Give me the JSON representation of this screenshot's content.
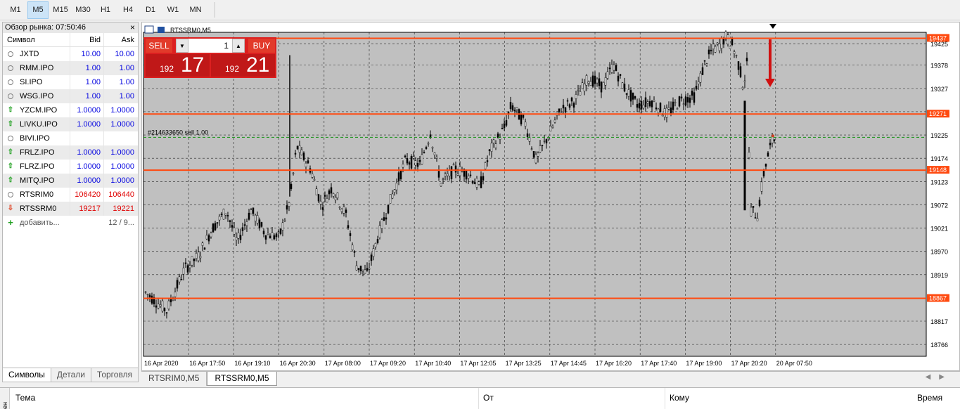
{
  "toolbar": {
    "timeframes": [
      "M1",
      "M5",
      "M15",
      "M30",
      "H1",
      "H4",
      "D1",
      "W1",
      "MN"
    ],
    "active_index": 1
  },
  "market_watch": {
    "title": "Обзор рынка: 07:50:46",
    "close": "×",
    "columns": {
      "symbol": "Символ",
      "bid": "Bid",
      "ask": "Ask"
    },
    "rows": [
      {
        "icon": "circle",
        "symbol": "JXTD",
        "bid": "10.00",
        "ask": "10.00",
        "color": "blue"
      },
      {
        "icon": "circle",
        "symbol": "RMM.IPO",
        "bid": "1.00",
        "ask": "1.00",
        "color": "blue"
      },
      {
        "icon": "circle",
        "symbol": "SI.IPO",
        "bid": "1.00",
        "ask": "1.00",
        "color": "blue"
      },
      {
        "icon": "circle",
        "symbol": "WSG.IPO",
        "bid": "1.00",
        "ask": "1.00",
        "color": "blue"
      },
      {
        "icon": "up",
        "symbol": "YZCM.IPO",
        "bid": "1.0000",
        "ask": "1.0000",
        "color": "blue"
      },
      {
        "icon": "up",
        "symbol": "LIVKU.IPO",
        "bid": "1.0000",
        "ask": "1.0000",
        "color": "blue"
      },
      {
        "icon": "circle",
        "symbol": "BIVI.IPO",
        "bid": "",
        "ask": "",
        "color": "blue"
      },
      {
        "icon": "up",
        "symbol": "FRLZ.IPO",
        "bid": "1.0000",
        "ask": "1.0000",
        "color": "blue"
      },
      {
        "icon": "up",
        "symbol": "FLRZ.IPO",
        "bid": "1.0000",
        "ask": "1.0000",
        "color": "blue"
      },
      {
        "icon": "up",
        "symbol": "MITQ.IPO",
        "bid": "1.0000",
        "ask": "1.0000",
        "color": "blue"
      },
      {
        "icon": "circle",
        "symbol": "RTSRIM0",
        "bid": "106420",
        "ask": "106440",
        "color": "red"
      },
      {
        "icon": "down",
        "symbol": "RTSSRM0",
        "bid": "19217",
        "ask": "19221",
        "color": "red"
      }
    ],
    "add_label": "добавить...",
    "count": "12 / 9...",
    "tabs": [
      "Символы",
      "Детали",
      "Торговля"
    ]
  },
  "chart": {
    "title": "RTSSRM0,M5",
    "trade_label": "#214633650 sell 1.00",
    "price_axis": [
      "19425",
      "19378",
      "19327",
      "19276",
      "19225",
      "19174",
      "19123",
      "19072",
      "19021",
      "18970",
      "18919",
      "18868",
      "18817",
      "18766"
    ],
    "time_axis": [
      "16 Apr 2020",
      "16 Apr 17:50",
      "16 Apr 19:10",
      "16 Apr 20:30",
      "17 Apr 08:00",
      "17 Apr 09:20",
      "17 Apr 10:40",
      "17 Apr 12:05",
      "17 Apr 13:25",
      "17 Apr 14:45",
      "17 Apr 16:20",
      "17 Apr 17:40",
      "17 Apr 19:00",
      "17 Apr 20:20",
      "20 Apr 07:50"
    ],
    "levels": [
      {
        "price": 19437,
        "label": "19437"
      },
      {
        "price": 19271,
        "label": "19271"
      },
      {
        "price": 19148,
        "label": "19148"
      },
      {
        "price": 18867,
        "label": "18867"
      }
    ],
    "trade_price": 19220,
    "level_color": "#ff4a10",
    "arrow_color": "#d01010"
  },
  "one_click": {
    "sell_label": "SELL",
    "buy_label": "BUY",
    "lot": "1",
    "sell_small": "192",
    "sell_big": "17",
    "buy_small": "192",
    "buy_big": "21"
  },
  "chart_tabs": [
    "RTSRIM0,M5",
    "RTSSRM0,M5"
  ],
  "mail": {
    "side_label": "ен",
    "subject": "Тема",
    "from": "От",
    "to": "Кому",
    "time": "Время"
  }
}
